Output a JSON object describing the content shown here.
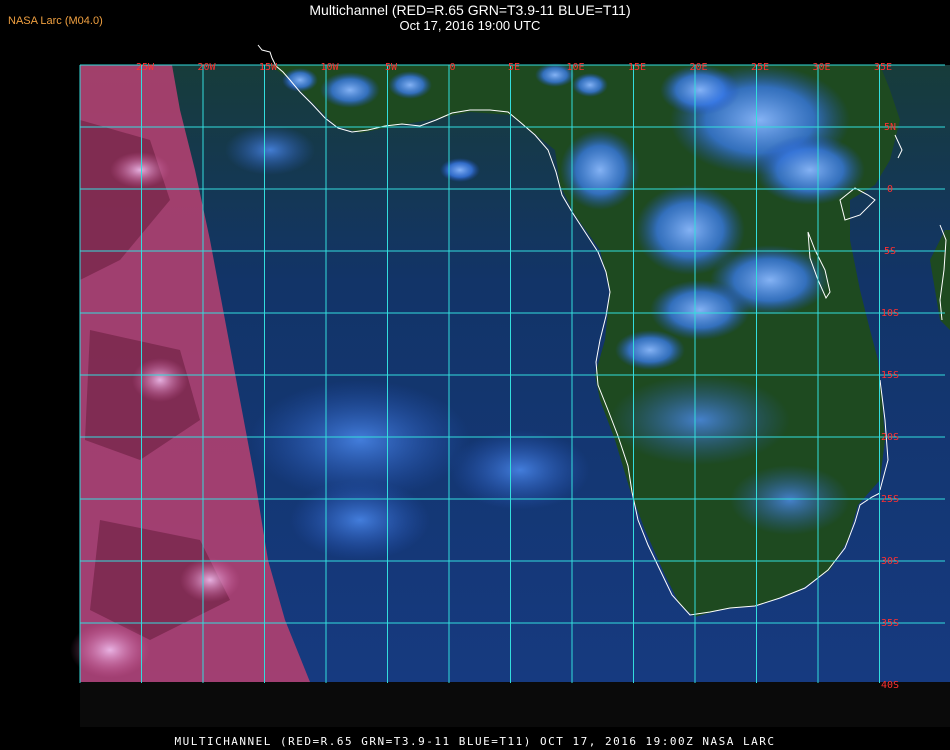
{
  "header": {
    "corner_label": "NASA Larc (M04.0)",
    "title": "Multichannel (RED=R.65 GRN=T3.9-11 BLUE=T11)",
    "datetime": "Oct 17, 2016 19:00 UTC"
  },
  "map": {
    "lon_labels": [
      "25W",
      "20W",
      "15W",
      "10W",
      "5W",
      "0",
      "5E",
      "10E",
      "15E",
      "20E",
      "25E",
      "30E",
      "35E"
    ],
    "lat_labels": [
      "5N",
      "0",
      "5S",
      "10S",
      "15S",
      "20S",
      "25S",
      "30S",
      "35S",
      "40S"
    ],
    "colors": {
      "grid": "#33dddd",
      "label": "#ff3030",
      "coast": "#ffffff",
      "ocean": "#123a78",
      "land": "#1b4a22",
      "cloud": "#3a8cff",
      "red_channel": "#d04a7a"
    }
  },
  "footer": {
    "text": "MULTICHANNEL (RED=R.65 GRN=T3.9-11 BLUE=T11) OCT 17, 2016 19:00Z   NASA LARC"
  }
}
